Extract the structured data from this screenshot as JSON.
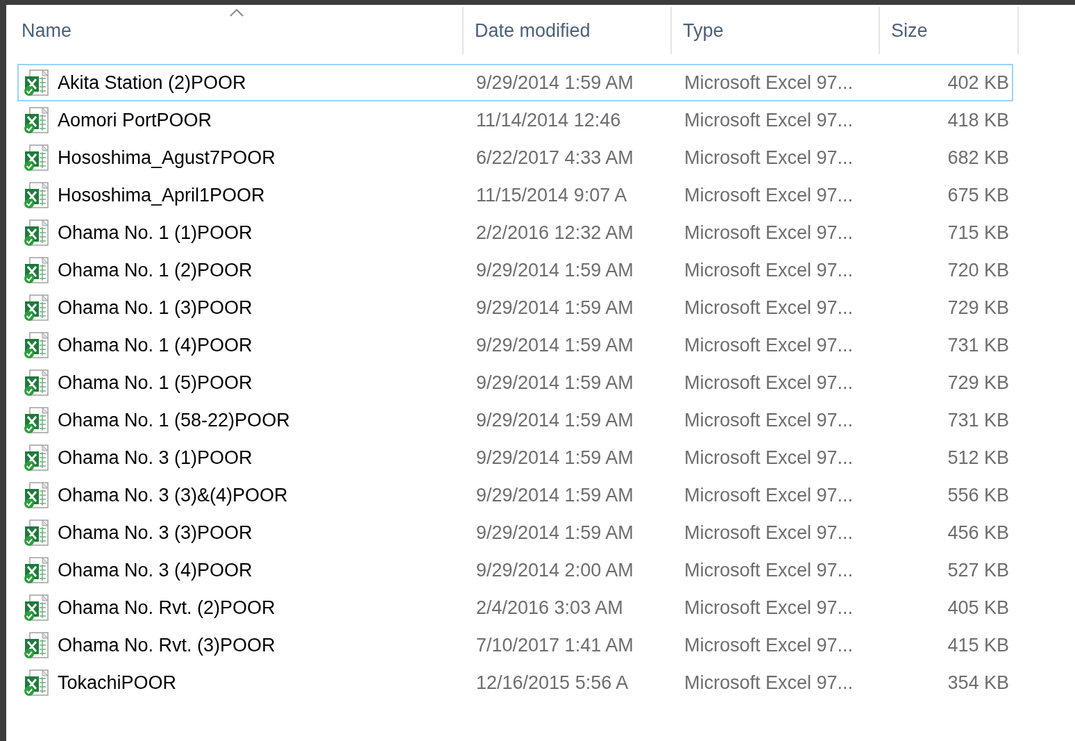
{
  "columns": [
    {
      "label": "Name",
      "sorted": true
    },
    {
      "label": "Date modified",
      "sorted": false
    },
    {
      "label": "Type",
      "sorted": false
    },
    {
      "label": "Size",
      "sorted": false
    }
  ],
  "files": [
    {
      "name": "Akita Station (2)POOR",
      "date": "9/29/2014 1:59 AM",
      "type": "Microsoft Excel 97...",
      "size": "402 KB",
      "selected": true
    },
    {
      "name": "Aomori PortPOOR",
      "date": "11/14/2014 12:46",
      "type": "Microsoft Excel 97...",
      "size": "418 KB",
      "selected": false
    },
    {
      "name": "Hososhima_Agust7POOR",
      "date": "6/22/2017 4:33 AM",
      "type": "Microsoft Excel 97...",
      "size": "682 KB",
      "selected": false
    },
    {
      "name": "Hososhima_April1POOR",
      "date": "11/15/2014 9:07 A",
      "type": "Microsoft Excel 97...",
      "size": "675 KB",
      "selected": false
    },
    {
      "name": "Ohama No. 1 (1)POOR",
      "date": "2/2/2016 12:32 AM",
      "type": "Microsoft Excel 97...",
      "size": "715 KB",
      "selected": false
    },
    {
      "name": "Ohama No. 1 (2)POOR",
      "date": "9/29/2014 1:59 AM",
      "type": "Microsoft Excel 97...",
      "size": "720 KB",
      "selected": false
    },
    {
      "name": "Ohama No. 1 (3)POOR",
      "date": "9/29/2014 1:59 AM",
      "type": "Microsoft Excel 97...",
      "size": "729 KB",
      "selected": false
    },
    {
      "name": "Ohama No. 1 (4)POOR",
      "date": "9/29/2014 1:59 AM",
      "type": "Microsoft Excel 97...",
      "size": "731 KB",
      "selected": false
    },
    {
      "name": "Ohama No. 1 (5)POOR",
      "date": "9/29/2014 1:59 AM",
      "type": "Microsoft Excel 97...",
      "size": "729 KB",
      "selected": false
    },
    {
      "name": "Ohama No. 1 (58-22)POOR",
      "date": "9/29/2014 1:59 AM",
      "type": "Microsoft Excel 97...",
      "size": "731 KB",
      "selected": false
    },
    {
      "name": "Ohama No. 3 (1)POOR",
      "date": "9/29/2014 1:59 AM",
      "type": "Microsoft Excel 97...",
      "size": "512 KB",
      "selected": false
    },
    {
      "name": "Ohama No. 3 (3)&(4)POOR",
      "date": "9/29/2014 1:59 AM",
      "type": "Microsoft Excel 97...",
      "size": "556 KB",
      "selected": false
    },
    {
      "name": "Ohama No. 3 (3)POOR",
      "date": "9/29/2014 1:59 AM",
      "type": "Microsoft Excel 97...",
      "size": "456 KB",
      "selected": false
    },
    {
      "name": "Ohama No. 3 (4)POOR",
      "date": "9/29/2014 2:00 AM",
      "type": "Microsoft Excel 97...",
      "size": "527 KB",
      "selected": false
    },
    {
      "name": "Ohama No. Rvt. (2)POOR",
      "date": "2/4/2016 3:03 AM",
      "type": "Microsoft Excel 97...",
      "size": "405 KB",
      "selected": false
    },
    {
      "name": "Ohama No. Rvt. (3)POOR",
      "date": "7/10/2017 1:41 AM",
      "type": "Microsoft Excel 97...",
      "size": "415 KB",
      "selected": false
    },
    {
      "name": "TokachiPOOR",
      "date": "12/16/2015 5:56 A",
      "type": "Microsoft Excel 97...",
      "size": "354 KB",
      "selected": false
    }
  ]
}
